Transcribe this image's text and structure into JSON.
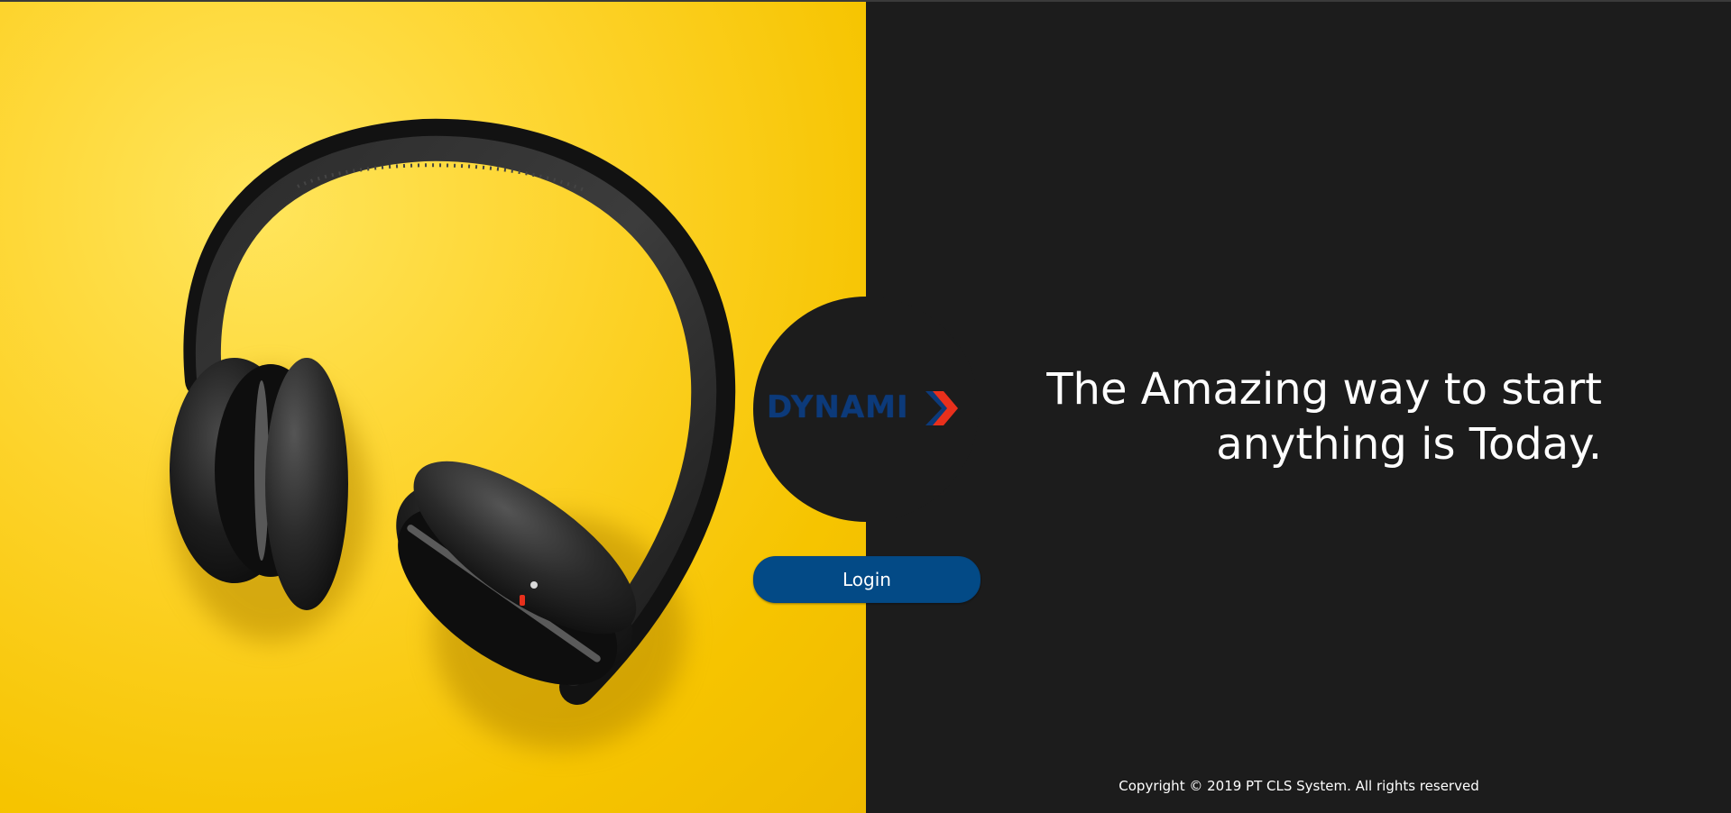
{
  "brand": {
    "logo_text": "DYNAMI",
    "logo_accent": "X",
    "logo_color": "#0c3a7a",
    "accent_color": "#e8301c"
  },
  "hero": {
    "tagline_line1": "The Amazing way to start",
    "tagline_line2": "anything is Today."
  },
  "actions": {
    "login_label": "Login"
  },
  "footer": {
    "copyright": "Copyright © 2019 PT CLS System. All rights reserved"
  },
  "colors": {
    "panel_dark": "#1c1c1c",
    "panel_yellow": "#fdd32a",
    "button_blue": "#034a86"
  },
  "images": {
    "left_panel": "headphones-on-yellow-photo"
  }
}
